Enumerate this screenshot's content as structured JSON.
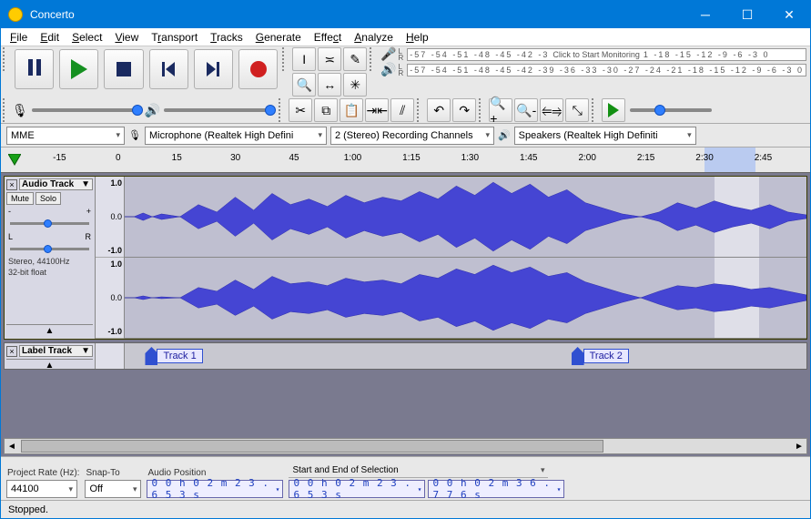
{
  "window": {
    "title": "Concerto"
  },
  "menu": {
    "items": [
      "File",
      "Edit",
      "Select",
      "View",
      "Transport",
      "Tracks",
      "Generate",
      "Effect",
      "Analyze",
      "Help"
    ]
  },
  "meters": {
    "rec_ticks": "-57 -54 -51 -48 -45 -42 -3",
    "rec_msg": "Click to Start Monitoring",
    "rec_ticks2": "1 -18 -15 -12  -9  -6  -3  0",
    "play_ticks": "-57 -54 -51 -48 -45 -42 -39 -36 -33 -30 -27 -24 -21 -18 -15 -12  -9  -6  -3  0"
  },
  "device": {
    "host": "MME",
    "input": "Microphone (Realtek High Defini",
    "channels": "2 (Stereo) Recording Channels",
    "output": "Speakers (Realtek High Definiti"
  },
  "timeline": {
    "ticks": [
      "-15",
      "0",
      "15",
      "30",
      "45",
      "1:00",
      "1:15",
      "1:30",
      "1:45",
      "2:00",
      "2:15",
      "2:30",
      "2:45"
    ]
  },
  "track": {
    "name": "Audio Track",
    "mute": "Mute",
    "solo": "Solo",
    "scale": [
      "1.0",
      "0.0",
      "-1.0"
    ],
    "info1": "Stereo, 44100Hz",
    "info2": "32-bit float",
    "pan_left": "L",
    "pan_right": "R",
    "gain_minus": "-",
    "gain_plus": "+"
  },
  "labeltrack": {
    "name": "Label Track",
    "labels": [
      "Track 1",
      "Track 2"
    ]
  },
  "bottom": {
    "rate_label": "Project Rate (Hz):",
    "rate": "44100",
    "snap_label": "Snap-To",
    "snap": "Off",
    "pos_label": "Audio Position",
    "pos": "0 0 h 0 2 m 2 3 . 6 5 3 s",
    "range_label": "Start and End of Selection",
    "start": "0 0 h 0 2 m 2 3 . 6 5 3 s",
    "end": "0 0 h 0 2 m 3 6 . 7 7 6 s"
  },
  "status": "Stopped."
}
